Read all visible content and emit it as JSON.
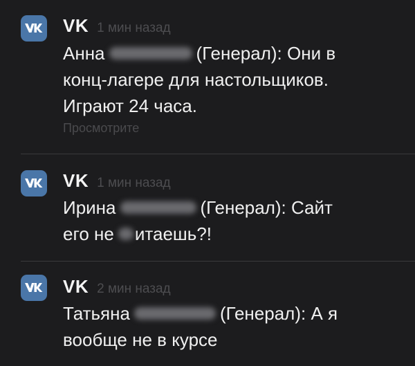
{
  "notifications": [
    {
      "app_name": "VK",
      "time": "1 мин назад",
      "first_name": "Анна",
      "rest_line1": "(Генерал): Они в",
      "line2": "конц-лагере для настольщиков.",
      "line3": "Играют 24 часа.",
      "action": "Просмотрите"
    },
    {
      "app_name": "VK",
      "time": "1 мин назад",
      "first_name": "Ирина",
      "rest_line1": "(Генерал): Сайт",
      "line2_a": "его не",
      "line2_b": "итаешь?!"
    },
    {
      "app_name": "VK",
      "time": "2 мин назад",
      "first_name": "Татьяна",
      "rest_line1": "(Генерал): А я",
      "line2": "вообще не в курсе"
    }
  ],
  "colors": {
    "background": "#1c1c1e",
    "vk_icon": "#4a76a8",
    "primary_text": "#f0f0f0",
    "secondary_text": "#4d4d50",
    "divider": "#3a3a3c"
  },
  "icons": {
    "app_icon": "vk-logo-icon"
  }
}
